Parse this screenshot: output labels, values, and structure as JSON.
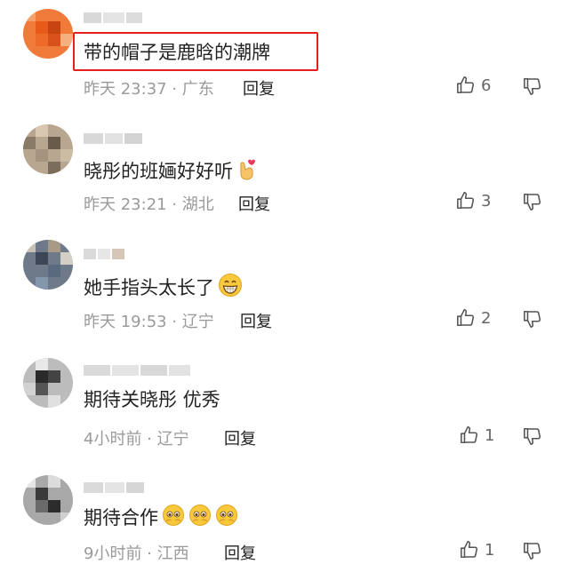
{
  "comments": [
    {
      "text": "带的帽子是鹿晗的潮牌",
      "time": "昨天 23:37",
      "location": "广东",
      "reply": "回复",
      "likes": "6",
      "emoji": []
    },
    {
      "text": "晓彤的班婳好好听",
      "time": "昨天 23:21",
      "location": "湖北",
      "reply": "回复",
      "likes": "3",
      "emoji": [
        "finger-heart-emoji"
      ]
    },
    {
      "text": "她手指头太长了",
      "time": "昨天 19:53",
      "location": "辽宁",
      "reply": "回复",
      "likes": "2",
      "emoji": [
        "grinning-emoji"
      ]
    },
    {
      "text": "期待关晓彤 优秀",
      "time": "4小时前",
      "location": "辽宁",
      "reply": "回复",
      "likes": "1",
      "emoji": []
    },
    {
      "text": "期待合作",
      "time": "9小时前",
      "location": "江西",
      "reply": "回复",
      "likes": "1",
      "emoji": [
        "pleading-emoji",
        "pleading-emoji",
        "pleading-emoji"
      ]
    }
  ],
  "separator": " · ",
  "colors": {
    "highlight_border": "#e8201c",
    "meta_text": "#9a9a9a",
    "body_text": "#222222"
  }
}
